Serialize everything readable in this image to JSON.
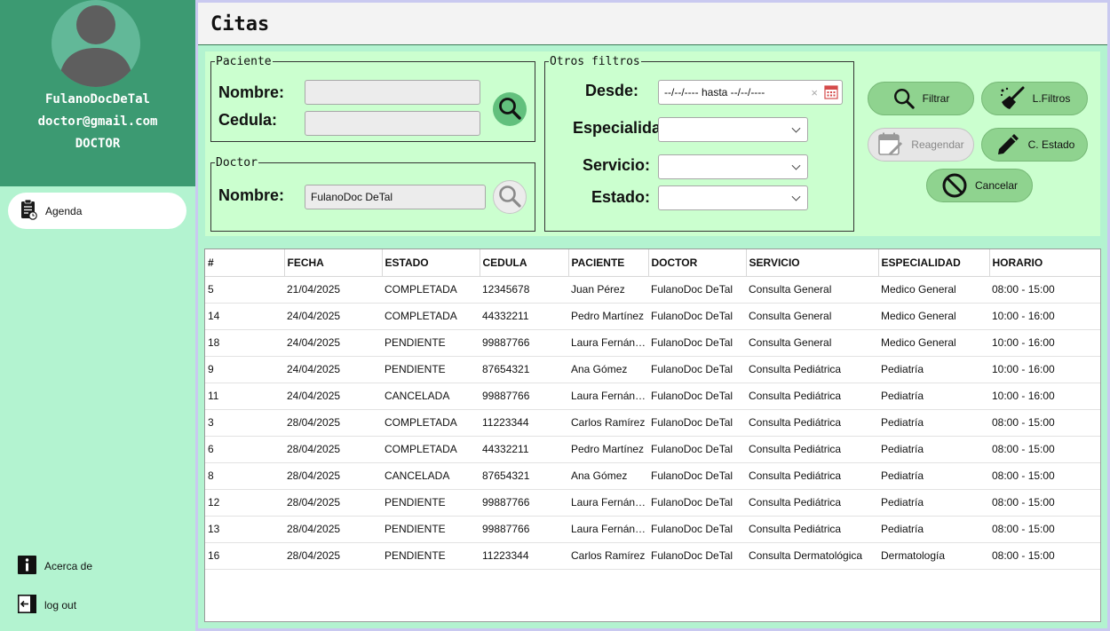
{
  "sidebar": {
    "user_name": "FulanoDocDeTal",
    "user_email": "doctor@gmail.com",
    "user_role": "DOCTOR",
    "nav_agenda": "Agenda",
    "about": "Acerca de",
    "logout": "log out"
  },
  "header": {
    "title": "Citas"
  },
  "paciente": {
    "legend": "Paciente",
    "nombre_label": "Nombre:",
    "nombre_value": "",
    "cedula_label": "Cedula:",
    "cedula_value": ""
  },
  "doctor": {
    "legend": "Doctor",
    "nombre_label": "Nombre:",
    "nombre_value": "FulanoDoc DeTal"
  },
  "otros": {
    "legend": "Otros filtros",
    "desde_label": "Desde:",
    "date_range": "--/--/---- hasta --/--/----",
    "especialidad_label": "Especialidad:",
    "servicio_label": "Servicio:",
    "estado_label": "Estado:"
  },
  "actions": {
    "filtrar": "Filtrar",
    "lfiltros": "L.Filtros",
    "reagendar": "Reagendar",
    "cestado": "C. Estado",
    "cancelar": "Cancelar"
  },
  "table": {
    "headers": [
      "#",
      "FECHA",
      "ESTADO",
      "CEDULA",
      "PACIENTE",
      "DOCTOR",
      "SERVICIO",
      "ESPECIALIDAD",
      "HORARIO"
    ],
    "rows": [
      [
        "5",
        "21/04/2025",
        "COMPLETADA",
        "12345678",
        "Juan Pérez",
        "FulanoDoc DeTal",
        "Consulta General",
        "Medico General",
        "08:00 - 15:00"
      ],
      [
        "14",
        "24/04/2025",
        "COMPLETADA",
        "44332211",
        "Pedro Martínez",
        "FulanoDoc DeTal",
        "Consulta General",
        "Medico General",
        "10:00 - 16:00"
      ],
      [
        "18",
        "24/04/2025",
        "PENDIENTE",
        "99887766",
        "Laura Fernánd...",
        "FulanoDoc DeTal",
        "Consulta General",
        "Medico General",
        "10:00 - 16:00"
      ],
      [
        "9",
        "24/04/2025",
        "PENDIENTE",
        "87654321",
        "Ana Gómez",
        "FulanoDoc DeTal",
        "Consulta Pediátrica",
        "Pediatría",
        "10:00 - 16:00"
      ],
      [
        "11",
        "24/04/2025",
        "CANCELADA",
        "99887766",
        "Laura Fernánd...",
        "FulanoDoc DeTal",
        "Consulta Pediátrica",
        "Pediatría",
        "10:00 - 16:00"
      ],
      [
        "3",
        "28/04/2025",
        "COMPLETADA",
        "11223344",
        "Carlos Ramírez",
        "FulanoDoc DeTal",
        "Consulta Pediátrica",
        "Pediatría",
        "08:00 - 15:00"
      ],
      [
        "6",
        "28/04/2025",
        "COMPLETADA",
        "44332211",
        "Pedro Martínez",
        "FulanoDoc DeTal",
        "Consulta Pediátrica",
        "Pediatría",
        "08:00 - 15:00"
      ],
      [
        "8",
        "28/04/2025",
        "CANCELADA",
        "87654321",
        "Ana Gómez",
        "FulanoDoc DeTal",
        "Consulta Pediátrica",
        "Pediatría",
        "08:00 - 15:00"
      ],
      [
        "12",
        "28/04/2025",
        "PENDIENTE",
        "99887766",
        "Laura Fernánd...",
        "FulanoDoc DeTal",
        "Consulta Pediátrica",
        "Pediatría",
        "08:00 - 15:00"
      ],
      [
        "13",
        "28/04/2025",
        "PENDIENTE",
        "99887766",
        "Laura Fernánd...",
        "FulanoDoc DeTal",
        "Consulta Pediátrica",
        "Pediatría",
        "08:00 - 15:00"
      ],
      [
        "16",
        "28/04/2025",
        "PENDIENTE",
        "11223344",
        "Carlos Ramírez",
        "FulanoDoc DeTal",
        "Consulta Dermatológica",
        "Dermatología",
        "08:00 - 15:00"
      ]
    ]
  },
  "icons": {
    "avatar": "user-avatar-icon",
    "agenda": "clipboard-clock-icon",
    "about": "info-icon",
    "logout": "logout-arrow-icon",
    "search": "magnifier-icon",
    "calendar": "calendar-icon",
    "broom": "broom-icon",
    "pencil": "pencil-icon",
    "cancel": "prohibited-icon"
  },
  "colors": {
    "sidebar_bg": "#b3f3d0",
    "profile_bg": "#3c9a72",
    "panel_bg": "#cbffcf",
    "button_bg": "#8fd38f",
    "search_active": "#62c07d"
  }
}
